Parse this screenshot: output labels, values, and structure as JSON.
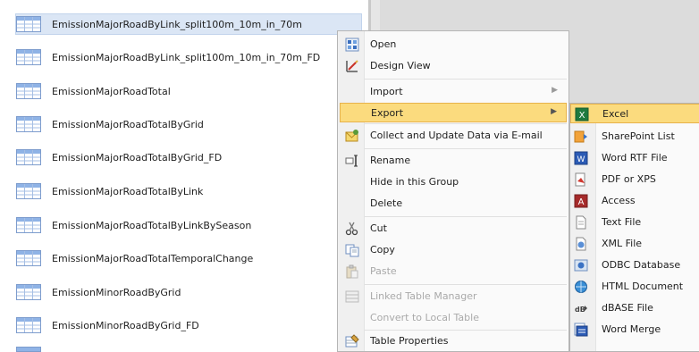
{
  "nav": {
    "items": [
      {
        "label": "EmissionMajorRoadByLink_split100m_10m_in_70m",
        "selected": true
      },
      {
        "label": "EmissionMajorRoadByLink_split100m_10m_in_70m_FD",
        "selected": false
      },
      {
        "label": "EmissionMajorRoadTotal",
        "selected": false
      },
      {
        "label": "EmissionMajorRoadTotalByGrid",
        "selected": false
      },
      {
        "label": "EmissionMajorRoadTotalByGrid_FD",
        "selected": false
      },
      {
        "label": "EmissionMajorRoadTotalByLink",
        "selected": false
      },
      {
        "label": "EmissionMajorRoadTotalByLinkBySeason",
        "selected": false
      },
      {
        "label": "EmissionMajorRoadTotalTemporalChange",
        "selected": false
      },
      {
        "label": "EmissionMinorRoadByGrid",
        "selected": false
      },
      {
        "label": "EmissionMinorRoadByGrid_FD",
        "selected": false
      }
    ]
  },
  "context_menu": {
    "open_label": "Open",
    "design_view_label": "Design View",
    "import_label": "Import",
    "export_label": "Export",
    "collect_label": "Collect and Update Data via E-mail",
    "rename_label": "Rename",
    "hide_label": "Hide in this Group",
    "delete_label": "Delete",
    "cut_label": "Cut",
    "copy_label": "Copy",
    "paste_label": "Paste",
    "linked_table_manager_label": "Linked Table Manager",
    "convert_label": "Convert to Local Table",
    "table_properties_label": "Table Properties"
  },
  "export_submenu": {
    "excel_label": "Excel",
    "sharepoint_label": "SharePoint List",
    "word_rtf_label": "Word RTF File",
    "pdf_label": "PDF or XPS",
    "access_label": "Access",
    "text_label": "Text File",
    "xml_label": "XML File",
    "odbc_label": "ODBC Database",
    "html_label": "HTML Document",
    "dbase_label": "dBASE File",
    "word_merge_label": "Word Merge"
  },
  "colors": {
    "highlight": "#fbdb7e",
    "selection": "#dbe6f5"
  }
}
